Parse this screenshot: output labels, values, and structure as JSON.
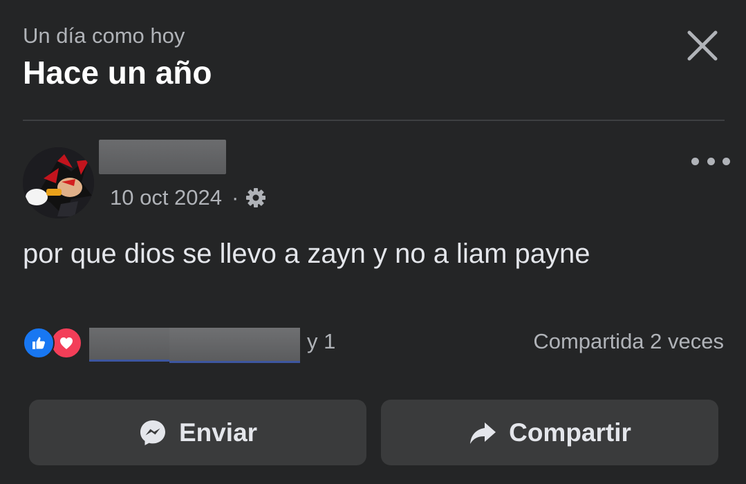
{
  "header": {
    "subtitle": "Un día como hoy",
    "title": "Hace un año"
  },
  "post": {
    "date": "10 oct 2024",
    "separator": "·",
    "privacy_icon": "gear-icon",
    "text": "por que dios se llevo a zayn y no a liam payne"
  },
  "reactions": {
    "types": [
      "like",
      "love"
    ],
    "more_text": "y 1",
    "shares": "Compartida 2 veces"
  },
  "actions": {
    "send_label": "Enviar",
    "share_label": "Compartir"
  },
  "colors": {
    "background": "#242526",
    "button": "#3a3b3c",
    "like": "#1877f2",
    "love": "#f33e58"
  }
}
